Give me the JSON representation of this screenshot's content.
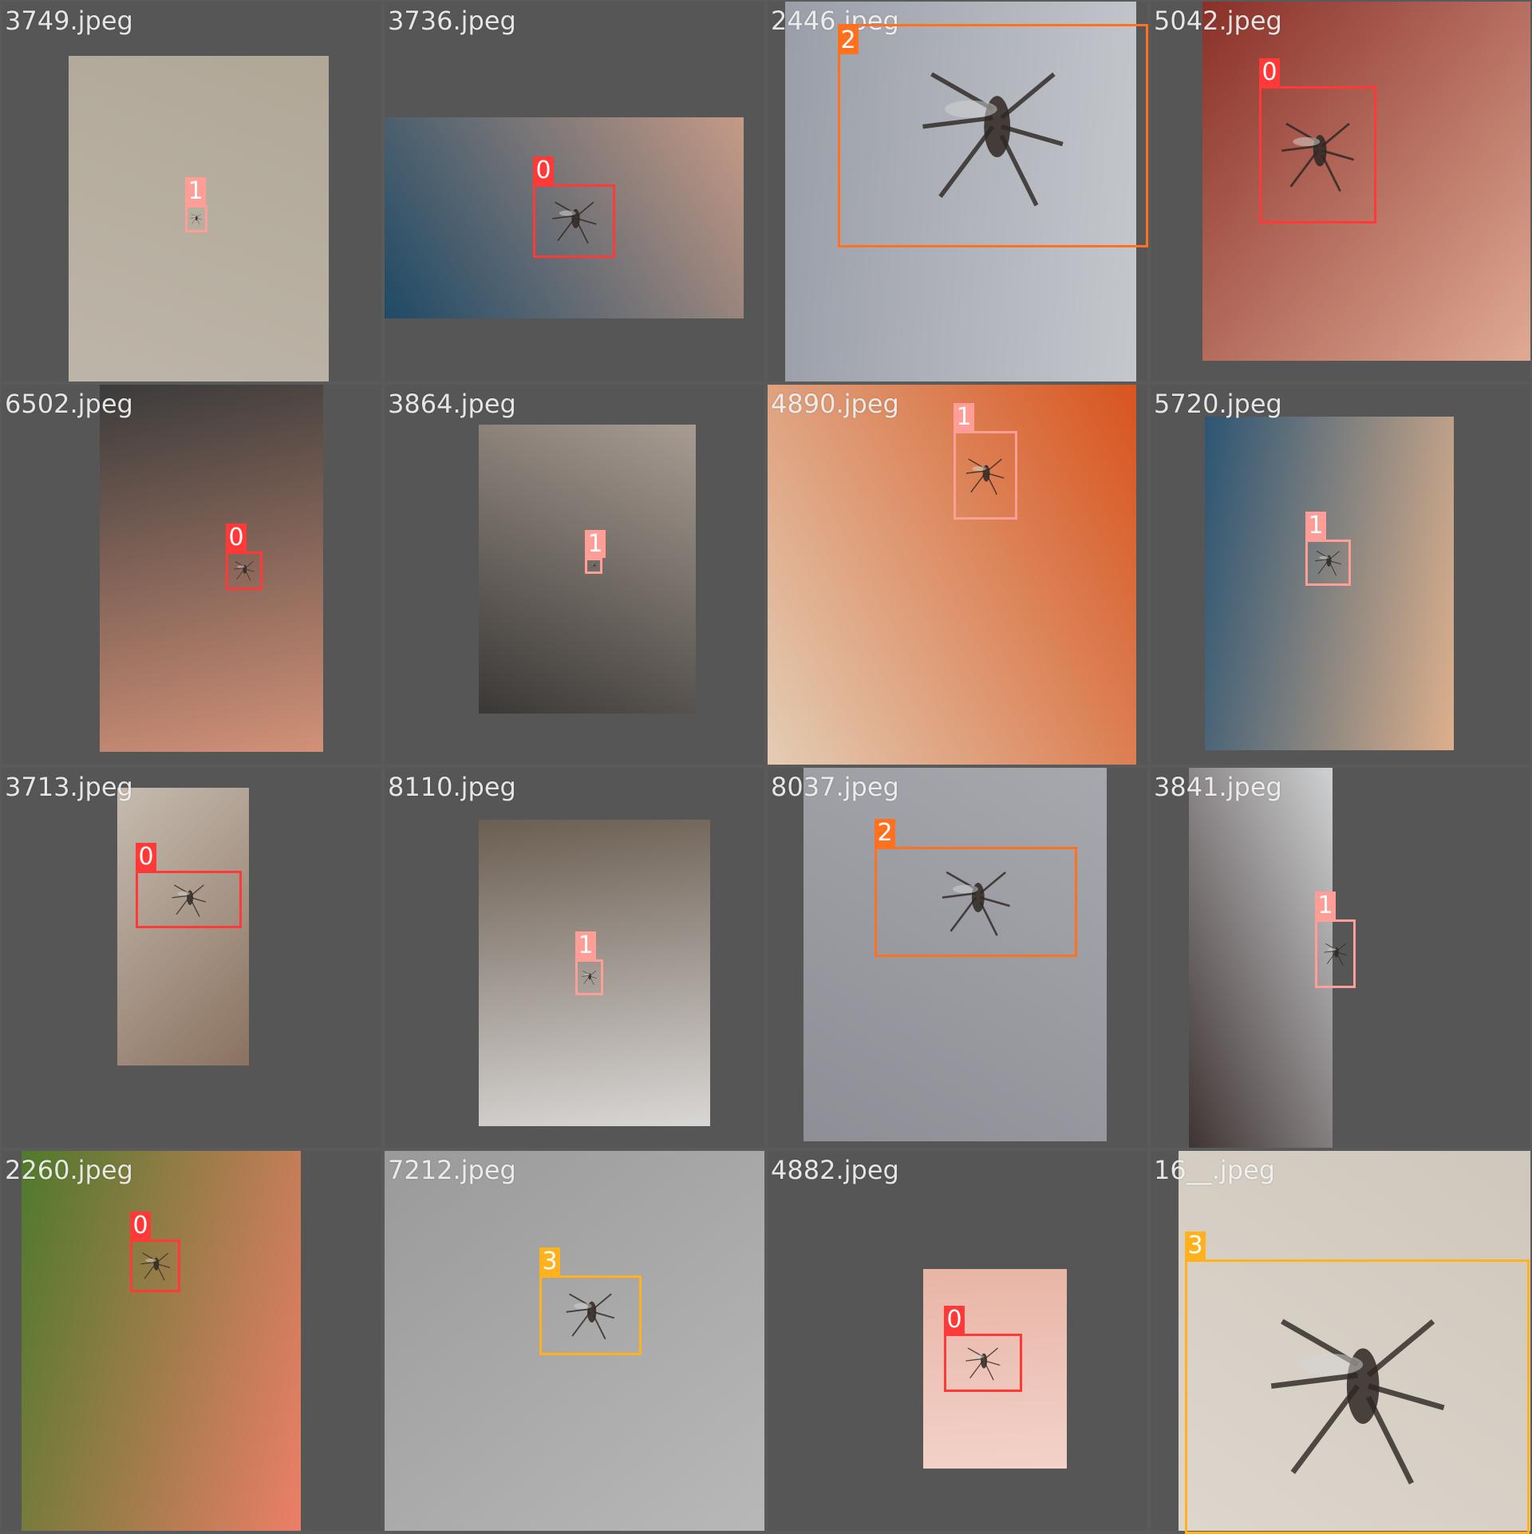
{
  "image_width": 1920,
  "image_height": 1920,
  "class_colors": {
    "0": "#ff3838",
    "1": "#ff9d97",
    "2": "#ff701f",
    "3": "#ffb21d"
  },
  "background_color": "#565656",
  "tiles": [
    {
      "filename": "3749.jpeg",
      "labels": [
        "1"
      ],
      "colors": [
        "#bdb5a8",
        "#b0a797"
      ]
    },
    {
      "filename": "3736.jpeg",
      "labels": [
        "0"
      ],
      "colors": [
        "#1e4a66",
        "#c69a86"
      ]
    },
    {
      "filename": "2446.jpeg",
      "labels": [
        "2"
      ],
      "colors": [
        "#9a9ea8",
        "#c4c7cc"
      ]
    },
    {
      "filename": "5042.jpeg",
      "labels": [
        "0"
      ],
      "colors": [
        "#8a3028",
        "#e0ab95"
      ]
    },
    {
      "filename": "6502.jpeg",
      "labels": [
        "0"
      ],
      "colors": [
        "#3b3b3b",
        "#d29177"
      ]
    },
    {
      "filename": "3864.jpeg",
      "labels": [
        "1"
      ],
      "colors": [
        "#3a3836",
        "#a89c92"
      ]
    },
    {
      "filename": "4890.jpeg",
      "labels": [
        "1"
      ],
      "colors": [
        "#e3cdb4",
        "#d8541e"
      ]
    },
    {
      "filename": "5720.jpeg",
      "labels": [
        "1"
      ],
      "colors": [
        "#2c5573",
        "#ddb08c"
      ]
    },
    {
      "filename": "3713.jpeg",
      "labels": [
        "0"
      ],
      "colors": [
        "#c6bcb0",
        "#8a7260"
      ]
    },
    {
      "filename": "8110.jpeg",
      "labels": [
        "1"
      ],
      "colors": [
        "#6b5e52",
        "#d9d7d5"
      ]
    },
    {
      "filename": "8037.jpeg",
      "labels": [
        "2"
      ],
      "colors": [
        "#8e8f96",
        "#a6a8ae"
      ]
    },
    {
      "filename": "3841.jpeg",
      "labels": [
        "1"
      ],
      "colors": [
        "#3f3434",
        "#cfd1d2"
      ]
    },
    {
      "filename": "2260.jpeg",
      "labels": [
        "0"
      ],
      "colors": [
        "#4f7a2c",
        "#ec7e67"
      ]
    },
    {
      "filename": "7212.jpeg",
      "labels": [
        "3"
      ],
      "colors": [
        "#9a9a9a",
        "#b8b8b8"
      ]
    },
    {
      "filename": "4882.jpeg",
      "labels": [
        "0"
      ],
      "colors": [
        "#e8b5a6",
        "#f3d2c9"
      ]
    },
    {
      "filename": "16__.jpeg",
      "labels": [
        "3"
      ],
      "colors": [
        "#ddd6cd",
        "#cfc7bb"
      ]
    }
  ]
}
